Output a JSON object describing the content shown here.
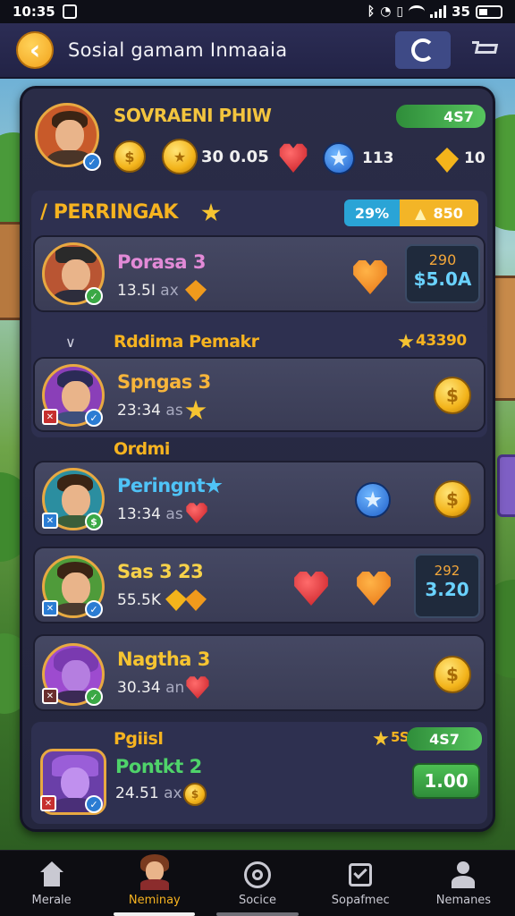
{
  "status_bar": {
    "time": "10:35",
    "battery": "35"
  },
  "header": {
    "title": "Sosial  gamam Inmaaia"
  },
  "profile": {
    "name": "SOVRAENI PHIW",
    "level": "4S7",
    "stat_value": "30 0.05",
    "stat_count": "113",
    "stat_gold": "10"
  },
  "sections": [
    {
      "title": "/ PERRINGAK",
      "pill_percent": "29%",
      "pill_coins": "850"
    },
    {
      "title": "Rddima Pemakr",
      "score": "43390"
    },
    {
      "title": "Ordmi"
    },
    {
      "title": "Pgiisl",
      "score": "5S",
      "pill": "4S7"
    }
  ],
  "players": [
    {
      "name": "Porasa 3",
      "name_color": "#e28ad7",
      "meta_value": "13.5I",
      "meta_unit": "ax",
      "price_top": "290",
      "price_main": "$5.0A"
    },
    {
      "name": "Spngas 3",
      "name_color": "#f7b53b",
      "meta_value": "23:34",
      "meta_unit": "as"
    },
    {
      "name": "Peringnt",
      "name_color": "#4fc3f7",
      "meta_value": "13:34",
      "meta_unit": "as"
    },
    {
      "name": "Sas 3 23",
      "name_color": "#f7d24a",
      "meta_value": "55.5K",
      "meta_unit": "",
      "price_top": "292",
      "price_main": "3.20"
    },
    {
      "name": "Nagtha 3",
      "name_color": "#f6c431",
      "meta_value": "30.34",
      "meta_unit": "an"
    },
    {
      "name": "Pontkt 2",
      "name_color": "#4fd36a",
      "meta_value": "24.51",
      "meta_unit": "ax",
      "price_main": "1.00"
    }
  ],
  "nav": [
    {
      "label": "Merale",
      "icon": "home-icon"
    },
    {
      "label": "Neminay",
      "icon": "character-icon"
    },
    {
      "label": "Socice",
      "icon": "social-icon"
    },
    {
      "label": "Sopafmec",
      "icon": "tasks-icon"
    },
    {
      "label": "Nemanes",
      "icon": "profile-icon"
    }
  ],
  "colors": {
    "accent": "#f2a21b",
    "panel": "#2a2c47",
    "card": "#424560",
    "green": "#4caf50"
  }
}
